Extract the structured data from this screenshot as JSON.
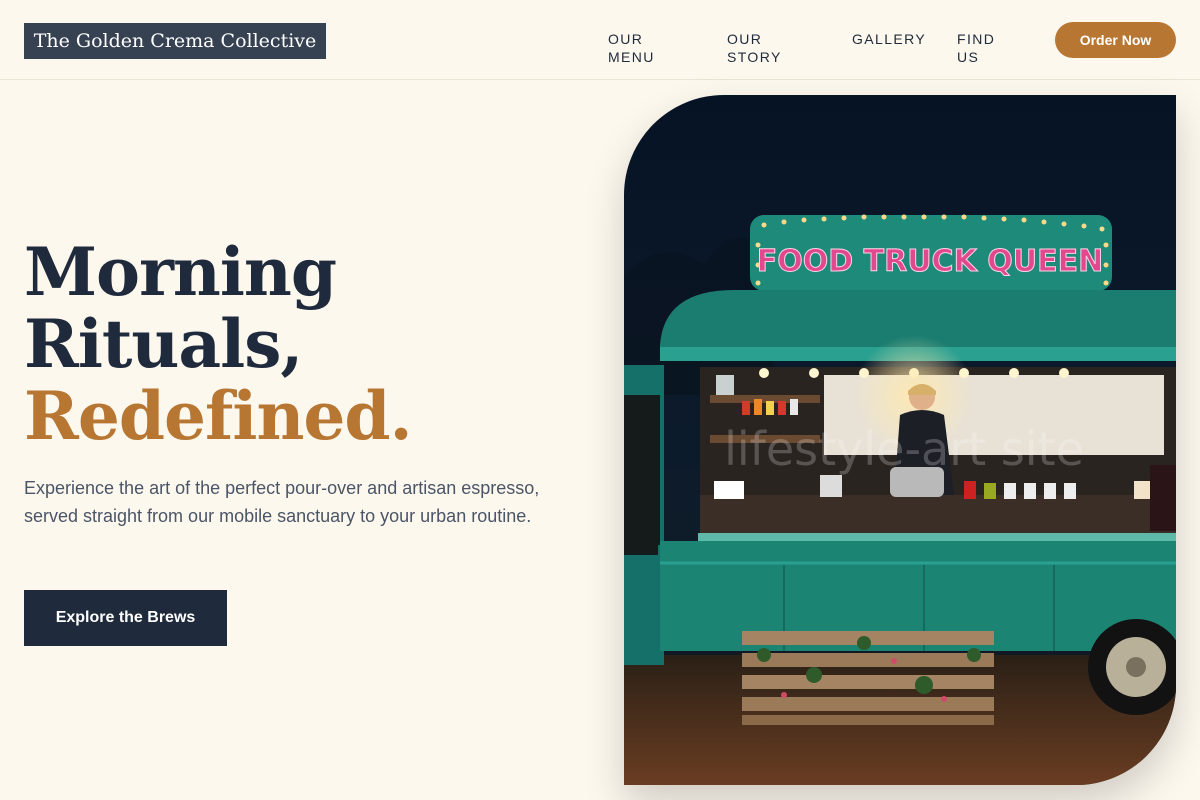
{
  "header": {
    "logo": "The Golden Crema Collective",
    "nav": [
      "OUR MENU",
      "OUR STORY",
      "GALLERY",
      "FIND US"
    ],
    "order_label": "Order Now"
  },
  "hero": {
    "title_line1": "Morning",
    "title_line2": "Rituals,",
    "title_accent": "Redefined.",
    "description": "Experience the art of the perfect pour-over and artisan espresso, served straight from our mobile sanctuary to your urban routine.",
    "cta_label": "Explore the Brews",
    "image": {
      "truck_sign": "FOOD TRUCK QUEEN",
      "watermark": "lifestyle-art site"
    }
  },
  "colors": {
    "background": "#fdf8ee",
    "navy": "#1f2a3c",
    "accent": "#b87633",
    "truck_teal": "#1e8a7a"
  }
}
